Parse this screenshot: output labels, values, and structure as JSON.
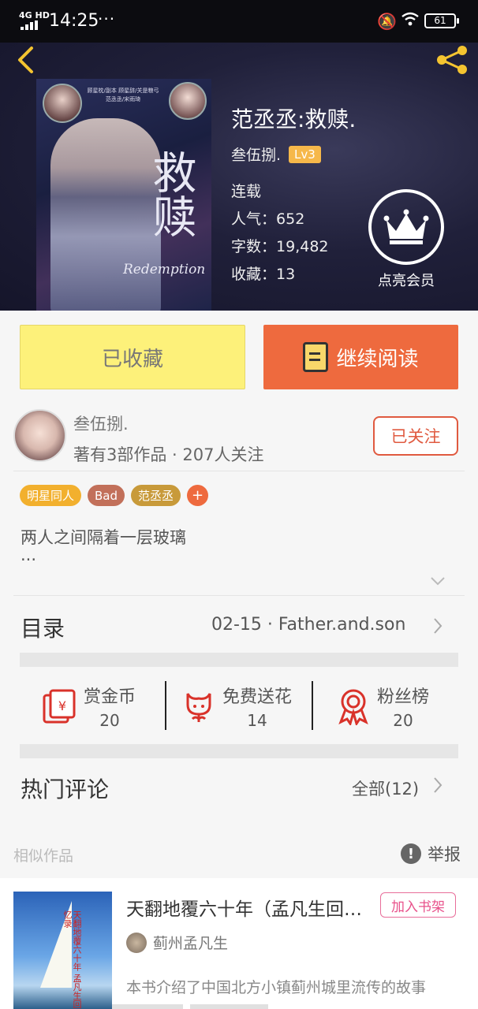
{
  "status_bar": {
    "network": "4G HD",
    "time": "14:25",
    "more": "···",
    "battery": "61"
  },
  "book": {
    "title": "范丞丞:救赎.",
    "author": "叁伍捌.",
    "level": "Lv3",
    "status": "连载",
    "popularity_label": "人气：",
    "popularity": "652",
    "words_label": "字数：",
    "words": "19,482",
    "favorites_label": "收藏：",
    "favorites": "13",
    "cover": {
      "big_text": "救赎",
      "subtitle": "Redemption",
      "credits": "顾星枕/副本 顾星辞/关是粮弓 范丞丞/宋雨琦"
    }
  },
  "vip": {
    "label": "点亮会员"
  },
  "actions": {
    "favorited_label": "已收藏",
    "continue_label": "继续阅读"
  },
  "author_card": {
    "name": "叁伍捌.",
    "stats": "著有3部作品 · 207人关注",
    "follow_label": "已关注"
  },
  "tags": [
    {
      "label": "明星同人",
      "color": "#f2b02e"
    },
    {
      "label": "Bad",
      "color": "#c2705a"
    },
    {
      "label": "范丞丞",
      "color": "#c89a3a"
    },
    {
      "label": "+",
      "color": "#ee6a3e"
    }
  ],
  "description": {
    "line1": "两人之间隔着一层玻璃",
    "line2": "···"
  },
  "toc": {
    "title": "目录",
    "latest": "02-15 · Father.and.son"
  },
  "stats": [
    {
      "label": "赏金币",
      "value": "20",
      "icon": "red-envelope-icon"
    },
    {
      "label": "免费送花",
      "value": "14",
      "icon": "flower-icon"
    },
    {
      "label": "粉丝榜",
      "value": "20",
      "icon": "medal-icon"
    }
  ],
  "comments": {
    "title": "热门评论",
    "all_label": "全部(12)"
  },
  "similar": {
    "title": "相似作品",
    "report_label": "举报",
    "items": [
      {
        "title": "天翻地覆六十年（孟凡生回忆录）",
        "author": "蓟州孟凡生",
        "desc": "本书介绍了中国北方小镇蓟州城里流传的故事",
        "add_label": "加入书架",
        "cover_text": "天翻地覆六十年 孟凡生回忆录"
      }
    ]
  },
  "colors": {
    "accent_orange": "#ee6a3e",
    "favorite_yellow": "#fdf17a",
    "back_arrow": "#f4c430",
    "follow_red": "#e05a40"
  }
}
